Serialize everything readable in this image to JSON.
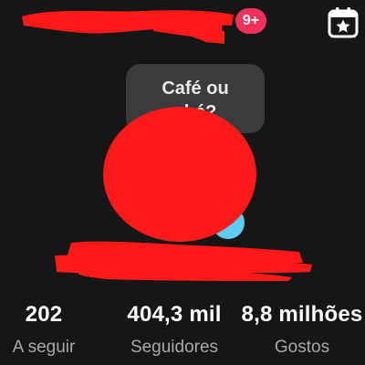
{
  "header": {
    "notification_badge": "9+",
    "calendar_icon": "calendar-star-icon",
    "badge_color": "#f0325a"
  },
  "profile": {
    "note": "Café ou\nchá?",
    "avatar_redaction_color": "#ff1a1a",
    "add_badge_color": "#5ecbf2"
  },
  "stats": [
    {
      "value": "202",
      "label": "A seguir"
    },
    {
      "value": "404,3 mil",
      "label": "Seguidores"
    },
    {
      "value": "8,8 milhões",
      "label": "Gostos"
    }
  ]
}
